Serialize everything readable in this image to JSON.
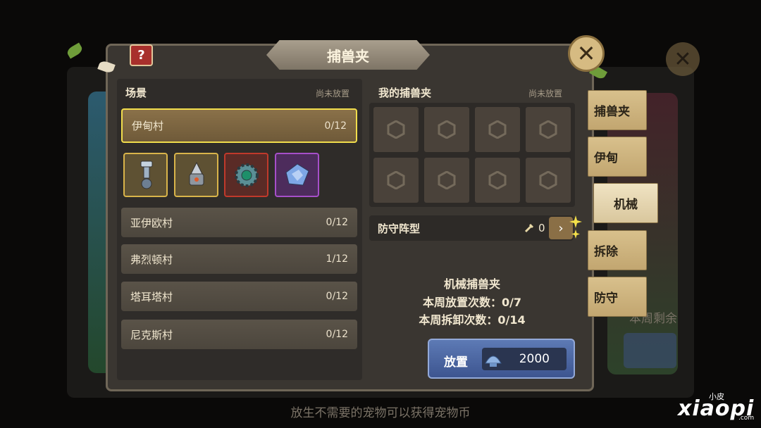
{
  "title": "捕兽夹",
  "help_label": "?",
  "close_label": "✕",
  "left": {
    "heading": "场景",
    "note": "尚未放置",
    "villages": [
      {
        "name": "伊甸村",
        "count": "0/12"
      },
      {
        "name": "亚伊欧村",
        "count": "0/12"
      },
      {
        "name": "弗烈顿村",
        "count": "1/12"
      },
      {
        "name": "塔耳塔村",
        "count": "0/12"
      },
      {
        "name": "尼克斯村",
        "count": "0/12"
      }
    ]
  },
  "right": {
    "heading": "我的捕兽夹",
    "note": "尚未放置",
    "defense_label": "防守阵型",
    "defense_count": "0",
    "arrow_label": "›",
    "info_title": "机械捕兽夹",
    "info_place": "本周放置次数：0/7",
    "info_remove": "本周拆卸次数：0/14",
    "place_label": "放置",
    "place_cost": "2000"
  },
  "tabs": [
    "捕兽夹",
    "伊甸",
    "机械",
    "拆除",
    "防守"
  ],
  "footer_hint": "放生不需要的宠物可以获得宠物币",
  "background": {
    "right_text": "本周剩余"
  },
  "watermark": {
    "big": "xiaopi",
    "small": "小皮",
    "com": ".com"
  },
  "colors": {
    "accent_yellow": "#f1dd4c",
    "tab_bg": "#d8c08c",
    "button_blue": "#4a66a3",
    "rare_gold": "#d9b44a",
    "rare_red": "#c0392b",
    "rare_purple": "#a64fc9"
  }
}
